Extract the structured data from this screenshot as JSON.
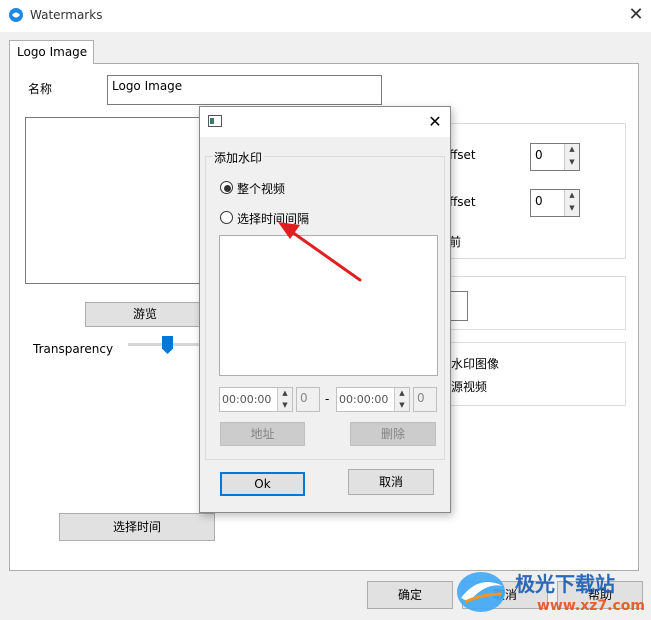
{
  "window": {
    "title": "Watermarks",
    "close": "✕"
  },
  "tabs": [
    {
      "label": "Logo Image"
    }
  ],
  "form": {
    "name_label": "名称",
    "name_value": "Logo Image",
    "browse_label": "游览",
    "transparency_label": "Transparency",
    "x_offset_label_partial": "ffset",
    "x_offset_value": "0",
    "y_offset_label_partial": "ffset",
    "y_offset_value": "0",
    "partial_label_1": "前",
    "option_watermark_image_partial": "水印图像",
    "option_source_video_partial": "源视频",
    "select_time_label": "选择时间"
  },
  "footer": {
    "ok_label": "确定",
    "cancel_label": "取消",
    "help_label": "帮助"
  },
  "dialog": {
    "close": "✕",
    "group_label": "添加水印",
    "radio_whole": "整个视频",
    "radio_interval": "选择时间间隔",
    "start_time": "00:00:00",
    "start_frame": "0",
    "dash": "-",
    "end_time": "00:00:00",
    "end_frame": "0",
    "address_label": "地址",
    "delete_label": "删除",
    "ok_label": "Ok",
    "cancel_label": "取消"
  },
  "watermark": {
    "brand_text": "极光下载站",
    "url_text": "www.xz7.com"
  },
  "colors": {
    "accent": "#0078d7",
    "arrow": "#e02020",
    "slider": "#0078d7"
  }
}
